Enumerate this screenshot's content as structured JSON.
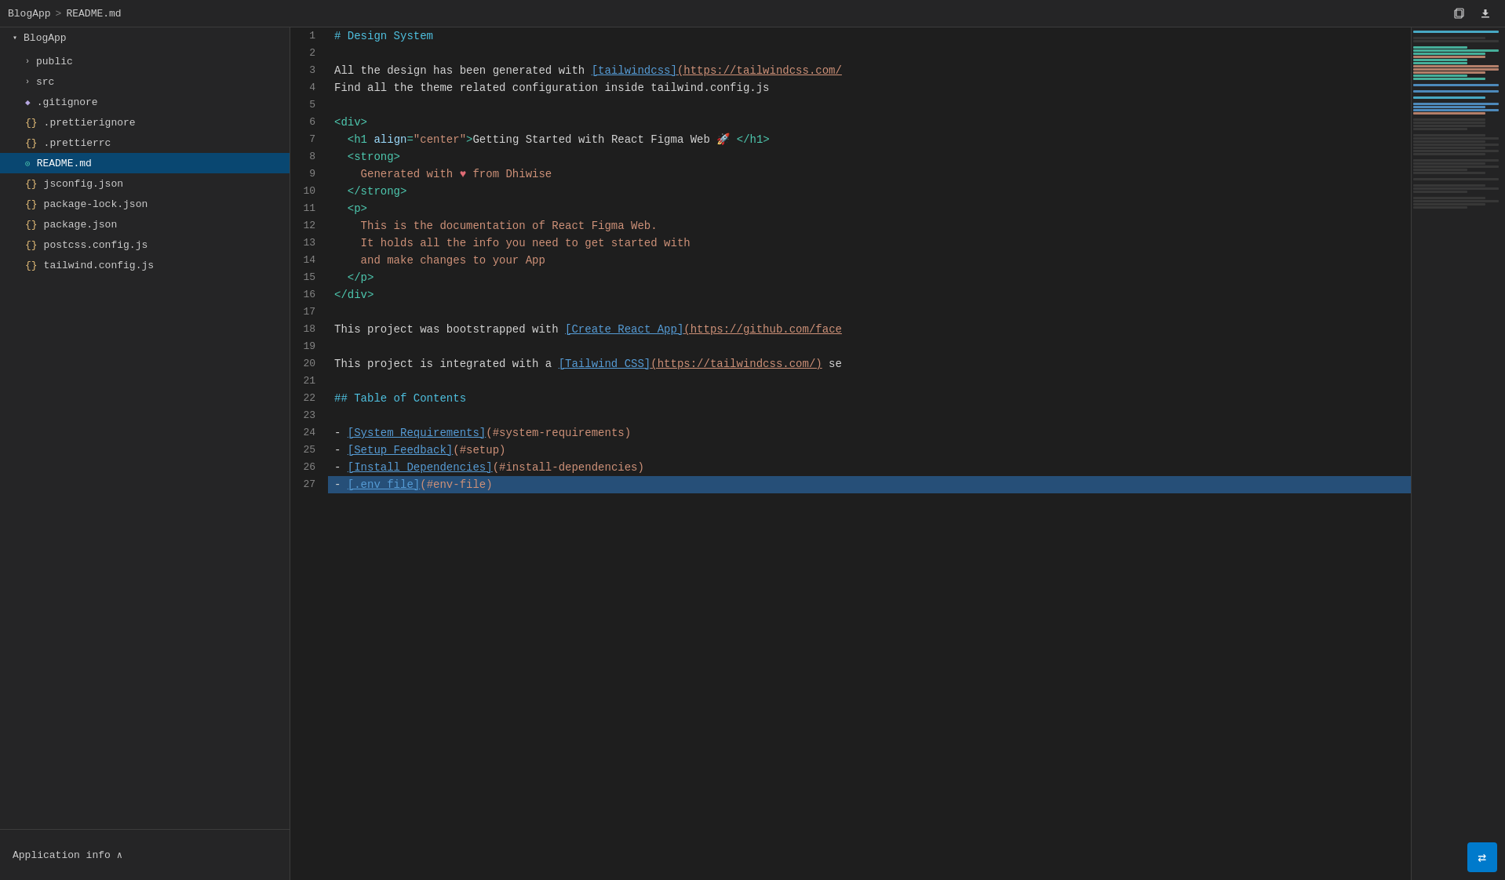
{
  "breadcrumb": {
    "project": "BlogApp",
    "separator": ">",
    "file": "README.md"
  },
  "toolbar": {
    "copy_btn": "⧉",
    "download_btn": "⬇"
  },
  "sidebar": {
    "project_name": "BlogApp",
    "items": [
      {
        "id": "public",
        "label": "public",
        "type": "folder",
        "icon": "chevron",
        "indent": 0
      },
      {
        "id": "src",
        "label": "src",
        "type": "folder",
        "icon": "chevron",
        "indent": 0
      },
      {
        "id": "gitignore",
        "label": ".gitignore",
        "type": "diamond",
        "indent": 0
      },
      {
        "id": "prettierignore",
        "label": ".prettierignore",
        "type": "bracket",
        "indent": 0
      },
      {
        "id": "prettierrc",
        "label": ".prettierrc",
        "type": "bracket",
        "indent": 0
      },
      {
        "id": "readme",
        "label": "README.md",
        "type": "circle",
        "indent": 0,
        "active": true
      },
      {
        "id": "jsconfig",
        "label": "jsconfig.json",
        "type": "bracket",
        "indent": 0
      },
      {
        "id": "packagelock",
        "label": "package-lock.json",
        "type": "bracket",
        "indent": 0
      },
      {
        "id": "package",
        "label": "package.json",
        "type": "bracket",
        "indent": 0
      },
      {
        "id": "postcss",
        "label": "postcss.config.js",
        "type": "bracket",
        "indent": 0
      },
      {
        "id": "tailwind",
        "label": "tailwind.config.js",
        "type": "bracket",
        "indent": 0
      }
    ],
    "footer_label": "Application info",
    "footer_chevron": "∧"
  },
  "code_lines": [
    {
      "num": 1,
      "content": "heading",
      "text": "# Design System"
    },
    {
      "num": 2,
      "content": "empty",
      "text": ""
    },
    {
      "num": 3,
      "content": "mixed",
      "text": "All the design has been generated with [tailwindcss](https://tailwindcss.com/"
    },
    {
      "num": 4,
      "content": "text",
      "text": "Find all the theme related configuration inside tailwind.config.js"
    },
    {
      "num": 5,
      "content": "empty",
      "text": ""
    },
    {
      "num": 6,
      "content": "tag",
      "text": "<div>"
    },
    {
      "num": 7,
      "content": "h1",
      "text": "  <h1 align=\"center\">Getting Started with React Figma Web 🚀 </h1>"
    },
    {
      "num": 8,
      "content": "strong",
      "text": "  <strong>"
    },
    {
      "num": 9,
      "content": "generated",
      "text": "    Generated with ♥ from Dhiwise"
    },
    {
      "num": 10,
      "content": "strong-close",
      "text": "  </strong>"
    },
    {
      "num": 11,
      "content": "p",
      "text": "  <p>"
    },
    {
      "num": 12,
      "content": "doc-text",
      "text": "    This is the documentation of React Figma Web."
    },
    {
      "num": 13,
      "content": "doc-text2",
      "text": "    It holds all the info you need to get started with"
    },
    {
      "num": 14,
      "content": "doc-text3",
      "text": "    and make changes to your App"
    },
    {
      "num": 15,
      "content": "p-close",
      "text": "  </p>"
    },
    {
      "num": 16,
      "content": "div-close",
      "text": "</div>"
    },
    {
      "num": 17,
      "content": "empty",
      "text": ""
    },
    {
      "num": 18,
      "content": "bootstrapped",
      "text": "This project was bootstrapped with [Create React App](https://github.com/face"
    },
    {
      "num": 19,
      "content": "empty",
      "text": ""
    },
    {
      "num": 20,
      "content": "integrated",
      "text": "This project is integrated with a [Tailwind CSS](https://tailwindcss.com/) se"
    },
    {
      "num": 21,
      "content": "empty",
      "text": ""
    },
    {
      "num": 22,
      "content": "toc-heading",
      "text": "## Table of Contents"
    },
    {
      "num": 23,
      "content": "empty",
      "text": ""
    },
    {
      "num": 24,
      "content": "list1",
      "text": "- [System Requirements](#system-requirements)"
    },
    {
      "num": 25,
      "content": "list2",
      "text": "- [Setup Feedback](#setup)"
    },
    {
      "num": 26,
      "content": "list3",
      "text": "- [Install Dependencies](#install-dependencies)"
    },
    {
      "num": 27,
      "content": "list4",
      "text": "- [.env file](#env-file)"
    }
  ],
  "bottom_right": {
    "icon": "⇄",
    "label": "terminal-icon"
  }
}
